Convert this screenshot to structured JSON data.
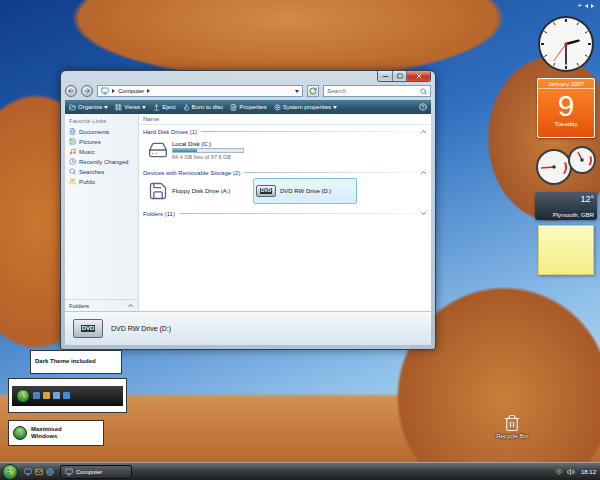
{
  "window": {
    "title": "Computer",
    "address": {
      "segments": [
        "Computer"
      ]
    },
    "search": {
      "placeholder": "Search"
    }
  },
  "toolbar": {
    "items": [
      {
        "label": "Organize",
        "kind": "organize",
        "dropdown": true
      },
      {
        "label": "Views",
        "kind": "views",
        "dropdown": true
      },
      {
        "label": "Eject",
        "kind": "eject",
        "dropdown": false
      },
      {
        "label": "Burn to disc",
        "kind": "burn",
        "dropdown": false
      },
      {
        "label": "Properties",
        "kind": "properties",
        "dropdown": false
      },
      {
        "label": "System properties",
        "kind": "system",
        "dropdown": true
      }
    ]
  },
  "sidebar": {
    "heading": "Favorite Links",
    "items": [
      {
        "label": "Documents",
        "kind": "documents"
      },
      {
        "label": "Pictures",
        "kind": "pictures"
      },
      {
        "label": "Music",
        "kind": "music"
      },
      {
        "label": "Recently Changed",
        "kind": "recent"
      },
      {
        "label": "Searches",
        "kind": "searches"
      },
      {
        "label": "Public",
        "kind": "public"
      }
    ],
    "footer": {
      "label": "Folders",
      "expanded": false
    }
  },
  "table": {
    "columns": [
      "Name"
    ],
    "groups": [
      {
        "title": "Hard Disk Drives (1)",
        "expanded": true,
        "items": [
          {
            "name": "Local Disk (C:)",
            "kind": "disk",
            "level": 0.34,
            "free": "64.4 GB free of 97.6 GB",
            "selected": false
          }
        ]
      },
      {
        "title": "Devices with Removable Storage (2)",
        "expanded": true,
        "items": [
          {
            "name": "Floppy Disk Drive (A:)",
            "kind": "floppy",
            "selected": false
          },
          {
            "name": "DVD RW Drive (D:)",
            "kind": "dvd",
            "badge": "DVD",
            "selected": true
          }
        ]
      },
      {
        "title": "Folders (11)",
        "expanded": false,
        "items": []
      }
    ]
  },
  "details": {
    "name": "DVD RW Drive (D:)",
    "kind": "dvd",
    "badge": "DVD"
  },
  "gadgets": {
    "bar": {
      "add": "+"
    },
    "clock": {
      "hours": 2,
      "minutes": 30,
      "seconds": 36
    },
    "calendar": {
      "month": "January 2007",
      "day": "9",
      "weekday": "Tuesday"
    },
    "meter": {
      "gauges": [
        {
          "level": 0.15
        },
        {
          "level": 0.4
        }
      ]
    },
    "weather": {
      "temperature": "12°",
      "location": "Plymouth, GBR"
    }
  },
  "desktop_icons": [
    {
      "label": "Recycle Bin"
    }
  ],
  "callouts": {
    "dark_theme": "Dark Theme included",
    "maximised": "Maximised Windows"
  },
  "taskbar": {
    "buttons": [
      {
        "label": "Computer",
        "selected": true
      }
    ],
    "clock": "18:12"
  }
}
